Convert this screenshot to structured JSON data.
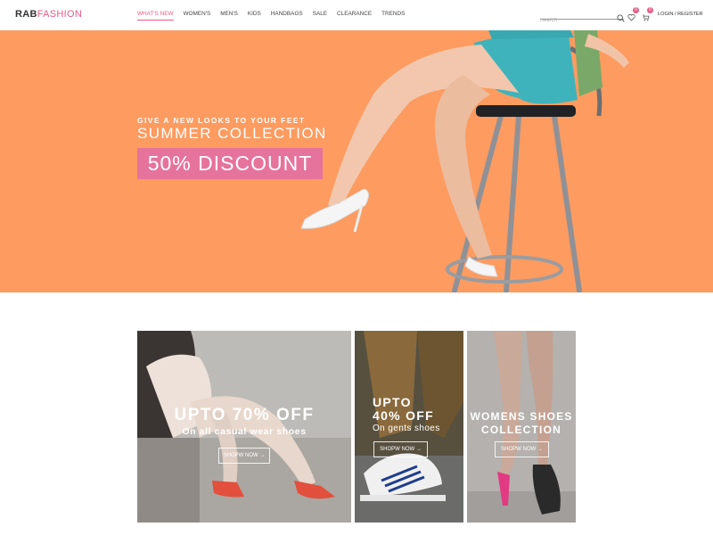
{
  "header": {
    "logo_part1": "RAB",
    "logo_part2": "FASHION",
    "nav": [
      "WHAT'S NEW",
      "WOMEN'S",
      "MEN'S",
      "KIDS",
      "HANDBAGS",
      "SALE",
      "CLEARANCE",
      "TRENDS"
    ],
    "search_placeholder": "Search",
    "wishlist_count": "0",
    "cart_count": "0",
    "login_label": "LOGIN / REGISTER"
  },
  "hero": {
    "tagline": "GIVE A NEW LOOKS TO YOUR FEET",
    "title": "SUMMER COLLECTION",
    "discount": "50% DISCOUNT"
  },
  "tiles": [
    {
      "line1": "UPTO 70% OFF",
      "line2": "On all casual wear shoes",
      "button": "SHOPW NOW →"
    },
    {
      "line1": "UPTO",
      "line2": "40% OFF",
      "line3": "On gents shoes",
      "button": "SHOPW NOW →"
    },
    {
      "line1": "WOMENS SHOES",
      "line2": "COLLECTION",
      "button": "SHOPW NOW →"
    }
  ],
  "colors": {
    "accent": "#e85a86",
    "hero_bg": "#fd9b60",
    "discount_bg": "#e6739c"
  },
  "icons": [
    "search-icon",
    "heart-icon",
    "cart-icon",
    "arrow-right-icon"
  ]
}
